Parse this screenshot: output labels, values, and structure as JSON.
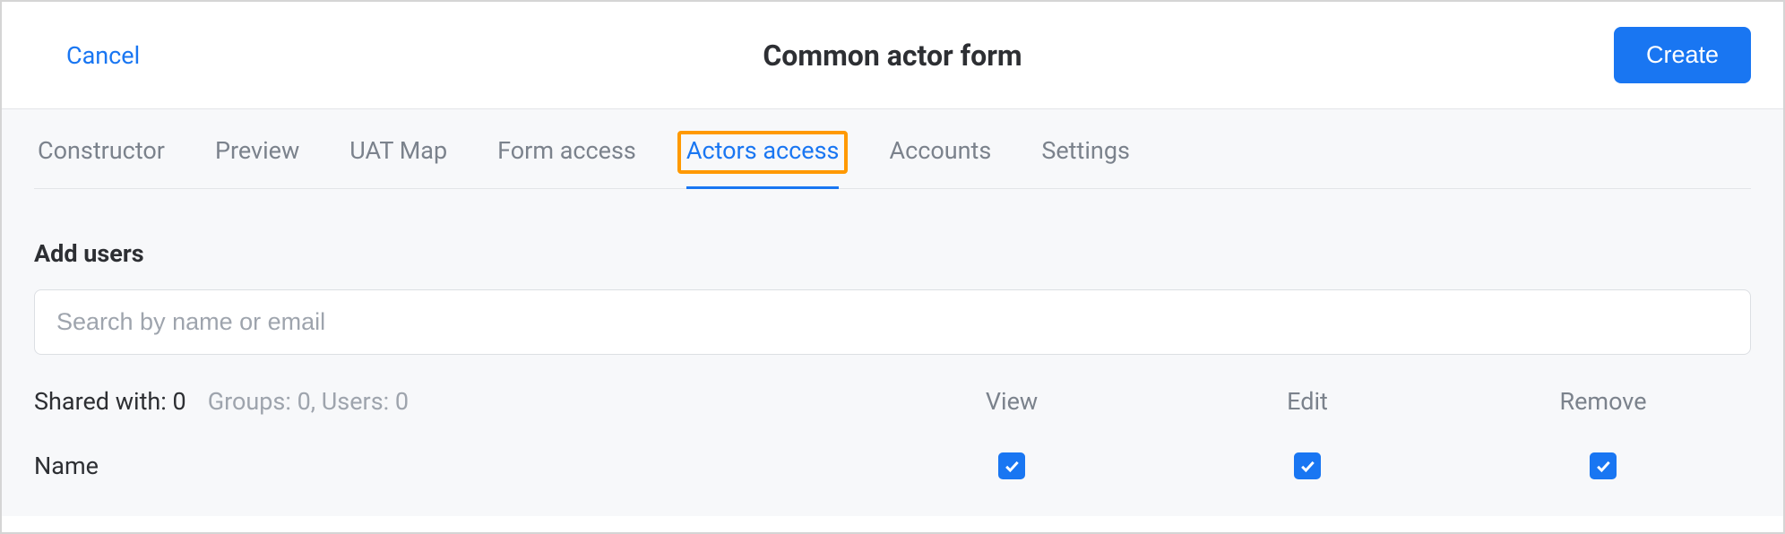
{
  "header": {
    "cancel_label": "Cancel",
    "title": "Common actor form",
    "create_label": "Create"
  },
  "tabs": [
    {
      "label": "Constructor",
      "active": false
    },
    {
      "label": "Preview",
      "active": false
    },
    {
      "label": "UAT Map",
      "active": false
    },
    {
      "label": "Form access",
      "active": false
    },
    {
      "label": "Actors access",
      "active": true,
      "highlighted": true
    },
    {
      "label": "Accounts",
      "active": false
    },
    {
      "label": "Settings",
      "active": false
    }
  ],
  "section": {
    "title": "Add users",
    "search_placeholder": "Search by name or email"
  },
  "stats": {
    "shared_with_label": "Shared with: 0",
    "groups_users_label": "Groups: 0, Users: 0"
  },
  "columns": {
    "view": "View",
    "edit": "Edit",
    "remove": "Remove"
  },
  "row": {
    "name_label": "Name",
    "view_checked": true,
    "edit_checked": true,
    "remove_checked": true
  }
}
